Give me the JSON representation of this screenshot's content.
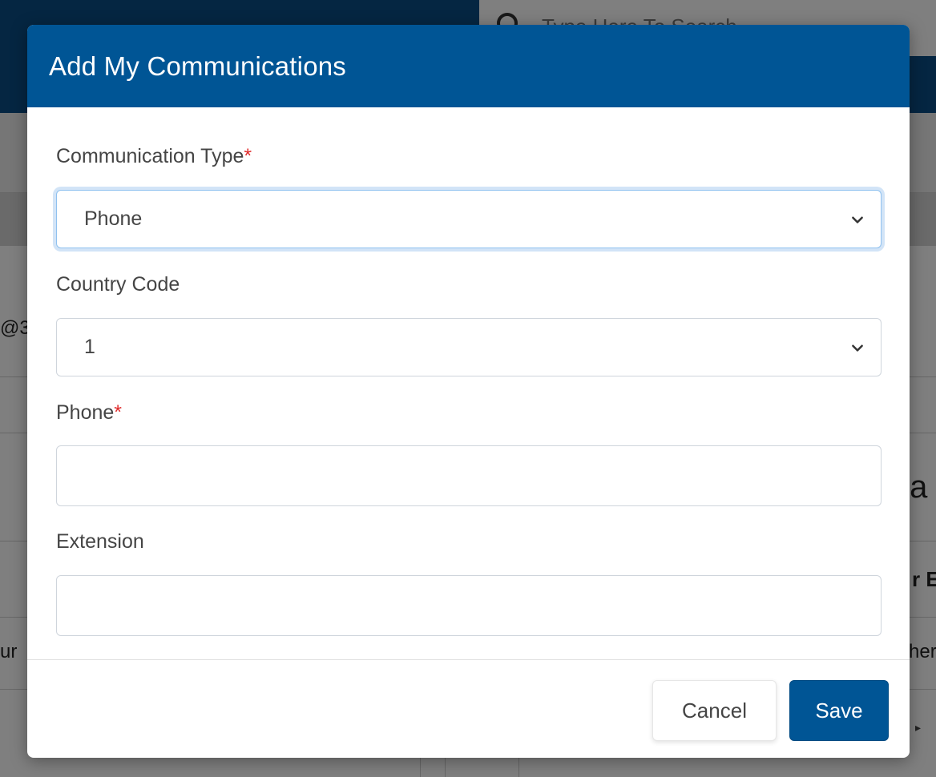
{
  "background": {
    "search_placeholder": "Type Here To Search",
    "fragment_a": "@3",
    "fragment_b": "ta",
    "fragment_c": "r E",
    "fragment_d": "ur",
    "fragment_e": "her",
    "fragment_f": "▸"
  },
  "modal": {
    "title": "Add My Communications",
    "fields": {
      "communication_type": {
        "label": "Communication Type",
        "required_mark": "*",
        "value": "Phone"
      },
      "country_code": {
        "label": "Country Code",
        "value": "1"
      },
      "phone": {
        "label": "Phone",
        "required_mark": "*",
        "value": ""
      },
      "extension": {
        "label": "Extension",
        "value": ""
      }
    },
    "footer": {
      "cancel_label": "Cancel",
      "save_label": "Save"
    }
  },
  "colors": {
    "header": "#005595",
    "primary_button": "#005595",
    "required": "#e02b2b",
    "focus_ring": "#8fc1ef"
  },
  "icons": {
    "select_chevron": "chevron-down-icon",
    "search": "search-icon"
  }
}
